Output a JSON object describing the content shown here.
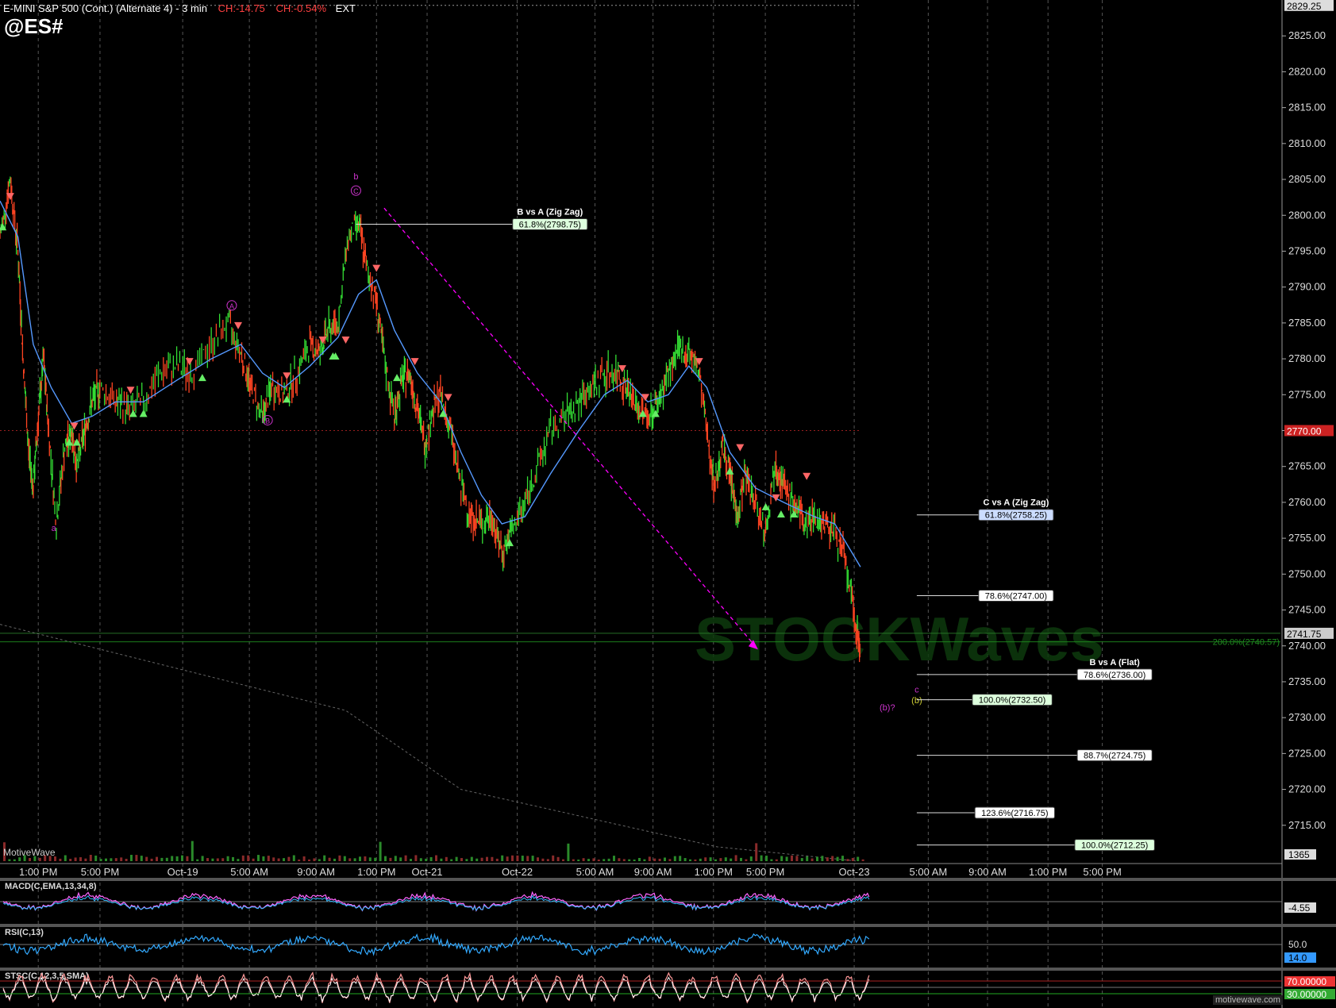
{
  "header": {
    "title": "E-MINI S&P 500 (Cont.) (Alternate 4) - 3 min",
    "ch_points": "CH:-14.75",
    "ch_percent": "CH:-0.54%",
    "session": "EXT",
    "symbol": "@ES#",
    "watermark_text": "STOCKWaves",
    "source_label": "MotiveWave",
    "footer_brand": "motivewave.com"
  },
  "colors": {
    "background": "#000000",
    "grid": "#7a7a7a",
    "up_bar": "#33dd33",
    "down_bar": "#ff4422",
    "moving_average": "#5599ff",
    "wave_label": "#cc33cc",
    "projection_line": "#ff00ff",
    "signal_up": "#66ee66",
    "signal_down": "#ff6666"
  },
  "chart_data": [
    {
      "type": "line",
      "panel": "price",
      "ylim": [
        2710,
        2830
      ],
      "y_ticks": [
        "2825.00",
        "2820.00",
        "2815.00",
        "2810.00",
        "2805.00",
        "2800.00",
        "2795.00",
        "2790.00",
        "2785.00",
        "2780.00",
        "2775.00",
        "2770.00",
        "2765.00",
        "2760.00",
        "2755.00",
        "2750.00",
        "2745.00",
        "2740.00",
        "2735.00",
        "2730.00",
        "2725.00",
        "2720.00",
        "2715.00"
      ],
      "x_ticks": [
        "1:00 PM",
        "5:00 PM",
        "Oct-19",
        "5:00 AM",
        "9:00 AM",
        "1:00 PM",
        "Oct-21",
        "Oct-22",
        "5:00 AM",
        "9:00 AM",
        "1:00 PM",
        "5:00 PM",
        "Oct-23",
        "5:00 AM",
        "9:00 AM",
        "1:00 PM",
        "5:00 PM"
      ],
      "x_units": "index (0 = left edge, 1 = right edge of price pane)",
      "price_path": [
        [
          0.0,
          2797
        ],
        [
          0.008,
          2805
        ],
        [
          0.014,
          2795
        ],
        [
          0.018,
          2780
        ],
        [
          0.022,
          2768
        ],
        [
          0.026,
          2762
        ],
        [
          0.03,
          2772
        ],
        [
          0.034,
          2780
        ],
        [
          0.038,
          2770
        ],
        [
          0.044,
          2757
        ],
        [
          0.05,
          2767
        ],
        [
          0.056,
          2770
        ],
        [
          0.06,
          2765
        ],
        [
          0.066,
          2770
        ],
        [
          0.072,
          2774
        ],
        [
          0.078,
          2776
        ],
        [
          0.09,
          2774
        ],
        [
          0.1,
          2773
        ],
        [
          0.112,
          2774
        ],
        [
          0.125,
          2778
        ],
        [
          0.138,
          2779
        ],
        [
          0.15,
          2778
        ],
        [
          0.165,
          2782
        ],
        [
          0.178,
          2785
        ],
        [
          0.188,
          2781
        ],
        [
          0.196,
          2776
        ],
        [
          0.205,
          2772
        ],
        [
          0.212,
          2776
        ],
        [
          0.222,
          2775
        ],
        [
          0.232,
          2778
        ],
        [
          0.242,
          2782
        ],
        [
          0.25,
          2781
        ],
        [
          0.256,
          2784
        ],
        [
          0.264,
          2785
        ],
        [
          0.272,
          2797
        ],
        [
          0.28,
          2799
        ],
        [
          0.286,
          2793
        ],
        [
          0.294,
          2788
        ],
        [
          0.3,
          2780
        ],
        [
          0.308,
          2772
        ],
        [
          0.314,
          2777
        ],
        [
          0.32,
          2778
        ],
        [
          0.326,
          2773
        ],
        [
          0.332,
          2768
        ],
        [
          0.338,
          2773
        ],
        [
          0.344,
          2775
        ],
        [
          0.352,
          2770
        ],
        [
          0.36,
          2762
        ],
        [
          0.368,
          2758
        ],
        [
          0.376,
          2757
        ],
        [
          0.384,
          2758
        ],
        [
          0.392,
          2753
        ],
        [
          0.4,
          2756
        ],
        [
          0.41,
          2760
        ],
        [
          0.42,
          2765
        ],
        [
          0.43,
          2770
        ],
        [
          0.442,
          2772
        ],
        [
          0.452,
          2774
        ],
        [
          0.462,
          2776
        ],
        [
          0.472,
          2778
        ],
        [
          0.482,
          2778
        ],
        [
          0.49,
          2776
        ],
        [
          0.498,
          2773
        ],
        [
          0.506,
          2772
        ],
        [
          0.514,
          2774
        ],
        [
          0.522,
          2778
        ],
        [
          0.53,
          2781
        ],
        [
          0.538,
          2781
        ],
        [
          0.546,
          2778
        ],
        [
          0.552,
          2770
        ],
        [
          0.558,
          2762
        ],
        [
          0.564,
          2768
        ],
        [
          0.57,
          2764
        ],
        [
          0.576,
          2758
        ],
        [
          0.582,
          2764
        ],
        [
          0.59,
          2760
        ],
        [
          0.598,
          2756
        ],
        [
          0.606,
          2766
        ],
        [
          0.612,
          2762
        ],
        [
          0.62,
          2760
        ],
        [
          0.628,
          2757
        ],
        [
          0.636,
          2758
        ],
        [
          0.644,
          2757
        ],
        [
          0.652,
          2756
        ],
        [
          0.66,
          2752
        ],
        [
          0.668,
          2743
        ],
        [
          0.672,
          2740
        ]
      ],
      "ma_path": [
        [
          0.0,
          2802
        ],
        [
          0.014,
          2797
        ],
        [
          0.026,
          2782
        ],
        [
          0.04,
          2776
        ],
        [
          0.056,
          2771
        ],
        [
          0.072,
          2772
        ],
        [
          0.09,
          2774
        ],
        [
          0.112,
          2774
        ],
        [
          0.138,
          2777
        ],
        [
          0.165,
          2780
        ],
        [
          0.188,
          2782
        ],
        [
          0.205,
          2778
        ],
        [
          0.222,
          2776
        ],
        [
          0.242,
          2779
        ],
        [
          0.264,
          2783
        ],
        [
          0.28,
          2789
        ],
        [
          0.294,
          2791
        ],
        [
          0.308,
          2784
        ],
        [
          0.326,
          2778
        ],
        [
          0.344,
          2774
        ],
        [
          0.36,
          2767
        ],
        [
          0.376,
          2761
        ],
        [
          0.392,
          2757
        ],
        [
          0.41,
          2758
        ],
        [
          0.43,
          2764
        ],
        [
          0.452,
          2770
        ],
        [
          0.472,
          2775
        ],
        [
          0.49,
          2777
        ],
        [
          0.506,
          2774
        ],
        [
          0.522,
          2775
        ],
        [
          0.538,
          2779
        ],
        [
          0.552,
          2776
        ],
        [
          0.57,
          2767
        ],
        [
          0.59,
          2762
        ],
        [
          0.612,
          2760
        ],
        [
          0.636,
          2758
        ],
        [
          0.652,
          2757
        ],
        [
          0.672,
          2751
        ]
      ],
      "wave_labels": [
        {
          "text": "a",
          "x": 0.042,
          "price": 2756
        },
        {
          "text": "A",
          "x": 0.181,
          "price": 2787,
          "circled": true
        },
        {
          "text": "B",
          "x": 0.209,
          "price": 2771,
          "circled": true
        },
        {
          "text": "b",
          "x": 0.278,
          "price": 2805
        },
        {
          "text": "C",
          "x": 0.278,
          "price": 2803,
          "circled": true
        },
        {
          "text": "(b)?",
          "x": 0.693,
          "price": 2731
        },
        {
          "text": "c",
          "x": 0.716,
          "price": 2733.5
        },
        {
          "text": "(b)",
          "x": 0.716,
          "price": 2732
        }
      ],
      "fib_levels": [
        {
          "label": "61.8%(2798.75)",
          "price": 2798.75,
          "from": 0.278,
          "to": 0.432,
          "title": "B vs A (Zig Zag)",
          "box": "#ddffdd"
        },
        {
          "label": "61.8%(2758.25)",
          "price": 2758.25,
          "from": 0.716,
          "to": 0.796,
          "title": "C vs A (Zig Zag)",
          "box": "#ccddff"
        },
        {
          "label": "78.6%(2747.00)",
          "price": 2747.0,
          "from": 0.716,
          "to": 0.796,
          "box": "#ffffff"
        },
        {
          "label": "78.6%(2736.00)",
          "price": 2736.0,
          "from": 0.716,
          "to": 0.873,
          "title": "B vs A (Flat)",
          "box": "#ffffff"
        },
        {
          "label": "100.0%(2732.50)",
          "price": 2732.5,
          "from": 0.716,
          "to": 0.793,
          "box": "#ddffdd"
        },
        {
          "label": "88.7%(2724.75)",
          "price": 2724.75,
          "from": 0.716,
          "to": 0.873,
          "box": "#ffffff"
        },
        {
          "label": "123.6%(2716.75)",
          "price": 2716.75,
          "from": 0.716,
          "to": 0.795,
          "box": "#ffffff"
        },
        {
          "label": "100.0%(2712.25)",
          "price": 2712.25,
          "from": 0.716,
          "to": 0.873,
          "box": "#ddffdd"
        }
      ],
      "reference_lines": [
        {
          "price": 2770.0,
          "label": "2770.00",
          "color": "#aa2222"
        },
        {
          "price": 2829.25,
          "label": "2829.25",
          "color": "#aaaaaa"
        },
        {
          "price": 2741.75,
          "label": "2741.75",
          "color": "#2a7a2a"
        },
        {
          "price": 2740.57,
          "label": "200.0%(2740.57)",
          "color": "#1f8a1f"
        }
      ],
      "channel_line": [
        [
          0.0,
          2743
        ],
        [
          0.27,
          2731
        ],
        [
          0.36,
          2720
        ],
        [
          0.56,
          2712
        ],
        [
          0.67,
          2710
        ]
      ],
      "projection_arrow": {
        "from": [
          0.3,
          2801
        ],
        "to": [
          0.592,
          2739.5
        ]
      },
      "signals_up": [
        [
          0.002,
          2799
        ],
        [
          0.054,
          2769
        ],
        [
          0.06,
          2769
        ],
        [
          0.104,
          2773
        ],
        [
          0.112,
          2773
        ],
        [
          0.158,
          2778
        ],
        [
          0.224,
          2775
        ],
        [
          0.26,
          2781
        ],
        [
          0.262,
          2781
        ],
        [
          0.31,
          2778
        ],
        [
          0.346,
          2773
        ],
        [
          0.398,
          2755
        ],
        [
          0.502,
          2773
        ],
        [
          0.512,
          2773
        ],
        [
          0.57,
          2765
        ],
        [
          0.598,
          2760
        ],
        [
          0.61,
          2759
        ],
        [
          0.62,
          2759
        ]
      ],
      "signals_down": [
        [
          0.008,
          2802
        ],
        [
          0.058,
          2770
        ],
        [
          0.102,
          2775
        ],
        [
          0.148,
          2779
        ],
        [
          0.186,
          2784
        ],
        [
          0.224,
          2777
        ],
        [
          0.252,
          2782
        ],
        [
          0.27,
          2782
        ],
        [
          0.294,
          2792
        ],
        [
          0.324,
          2779
        ],
        [
          0.35,
          2774
        ],
        [
          0.486,
          2778
        ],
        [
          0.504,
          2774
        ],
        [
          0.546,
          2779
        ],
        [
          0.578,
          2767
        ],
        [
          0.606,
          2760
        ],
        [
          0.63,
          2763
        ]
      ],
      "volume_label": "1365"
    },
    {
      "type": "line",
      "panel": "macd",
      "title": "MACD(C,EMA,13,34,8)",
      "last_value": "-4.55"
    },
    {
      "type": "line",
      "panel": "rsi",
      "title": "RSI(C,13)",
      "levels": [
        "50.0"
      ],
      "last_value": "14.0"
    },
    {
      "type": "line",
      "panel": "stochastic",
      "title": "STSC(C,12,3,5,SMA)",
      "levels": [
        "70.00000",
        "30.00000"
      ]
    }
  ]
}
